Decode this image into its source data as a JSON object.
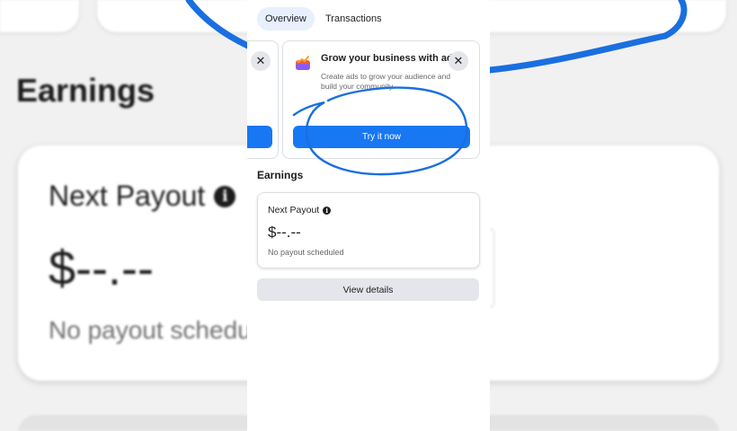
{
  "background": {
    "section_title": "Earnings",
    "payout_title": "Next Payout",
    "payout_amount": "$--.--",
    "payout_status": "No payout scheduled"
  },
  "tabs": [
    {
      "label": "Overview",
      "active": true
    },
    {
      "label": "Transactions",
      "active": false
    }
  ],
  "promo": {
    "title": "Grow your business with ads",
    "description": "Create ads to grow your audience and build your community.",
    "cta_label": "Try it now",
    "close_symbol": "✕",
    "icon": "ads-chart-icon"
  },
  "earnings": {
    "section_title": "Earnings",
    "next_payout_label": "Next Payout",
    "info_symbol": "i",
    "amount": "$--.--",
    "status": "No payout scheduled",
    "view_details_label": "View details"
  },
  "colors": {
    "primary_button": "#1877f2",
    "secondary_button": "#e4e6eb",
    "active_tab": "#e7f0fc",
    "annotation_ink": "#1a6fe0"
  }
}
